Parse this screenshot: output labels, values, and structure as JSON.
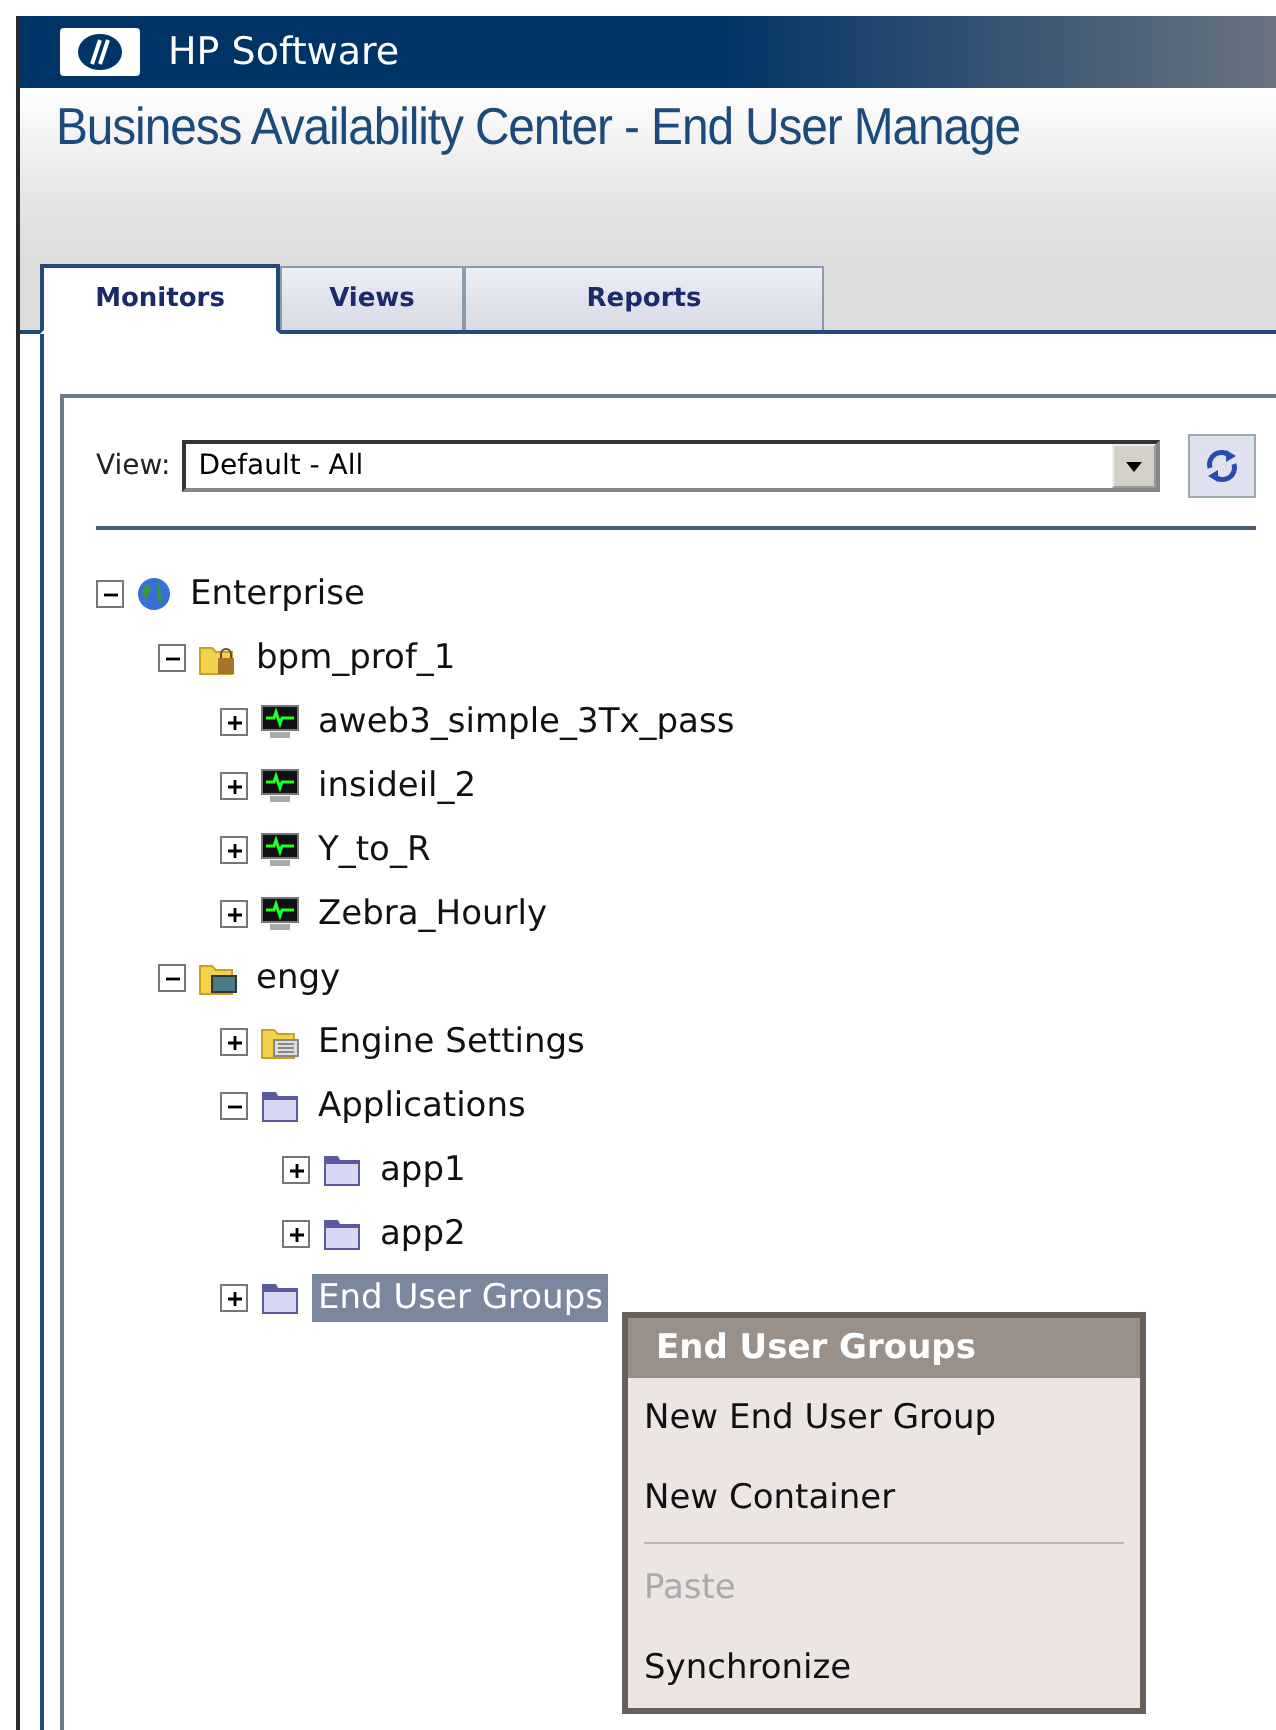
{
  "header": {
    "brand": "HP Software",
    "title": "Business Availability Center - End User Manage"
  },
  "tabs": [
    {
      "label": "Monitors",
      "selected": true
    },
    {
      "label": "Views",
      "selected": false
    },
    {
      "label": "Reports",
      "selected": false
    }
  ],
  "view": {
    "label": "View:",
    "value": "Default - All"
  },
  "tree": [
    {
      "label": "Enterprise",
      "kind": "globe",
      "expanded": true,
      "selected": false,
      "children": [
        {
          "label": "bpm_prof_1",
          "kind": "locked-folder",
          "expanded": true,
          "selected": false,
          "children": [
            {
              "label": "aweb3_simple_3Tx_pass",
              "kind": "monitor",
              "expanded": false,
              "selected": false
            },
            {
              "label": "insideil_2",
              "kind": "monitor",
              "expanded": false,
              "selected": false
            },
            {
              "label": "Y_to_R",
              "kind": "monitor",
              "expanded": false,
              "selected": false
            },
            {
              "label": "Zebra_Hourly",
              "kind": "monitor",
              "expanded": false,
              "selected": false
            }
          ]
        },
        {
          "label": "engy",
          "kind": "app-folder",
          "expanded": true,
          "selected": false,
          "children": [
            {
              "label": "Engine Settings",
              "kind": "settings-folder",
              "expanded": false,
              "selected": false
            },
            {
              "label": "Applications",
              "kind": "folder",
              "expanded": true,
              "selected": false,
              "children": [
                {
                  "label": "app1",
                  "kind": "folder",
                  "expanded": false,
                  "selected": false
                },
                {
                  "label": "app2",
                  "kind": "folder",
                  "expanded": false,
                  "selected": false
                }
              ]
            },
            {
              "label": "End User Groups",
              "kind": "folder",
              "expanded": false,
              "selected": true
            }
          ]
        }
      ]
    }
  ],
  "context_menu": {
    "title": "End User Groups",
    "items": [
      {
        "label": "New End User Group",
        "kind": "item",
        "disabled": false
      },
      {
        "label": "New Container",
        "kind": "item",
        "disabled": false
      },
      {
        "kind": "separator"
      },
      {
        "label": "Paste",
        "kind": "item",
        "disabled": true
      },
      {
        "label": "Synchronize",
        "kind": "item",
        "disabled": false
      }
    ]
  }
}
